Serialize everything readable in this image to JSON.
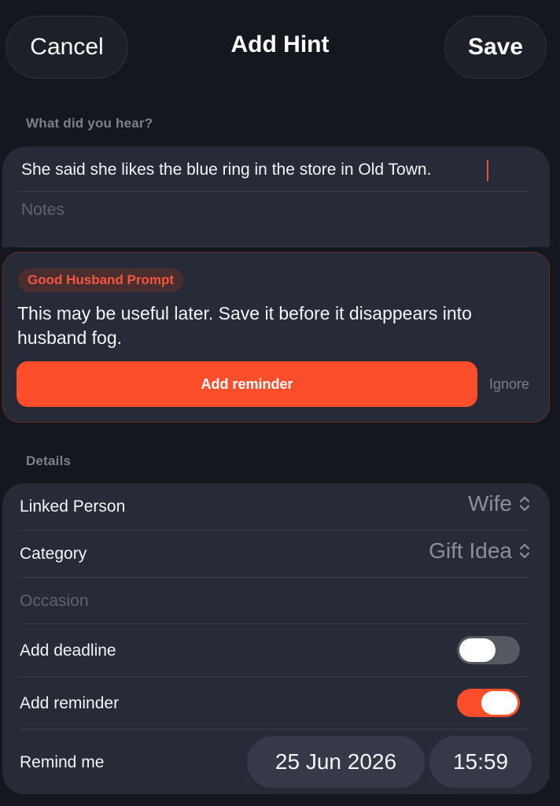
{
  "header": {
    "cancel_label": "Cancel",
    "title": "Add Hint",
    "save_label": "Save"
  },
  "hint_section": {
    "label": "What did you hear?",
    "text": "She said she likes the blue ring in the store in Old Town.",
    "notes_placeholder": "Notes"
  },
  "prompt": {
    "badge": "Good Husband Prompt",
    "message": "This may be useful later. Save it before it disappears into husband fog.",
    "primary_label": "Add reminder",
    "secondary_label": "Ignore"
  },
  "details": {
    "label": "Details",
    "linked_person": {
      "label": "Linked Person",
      "value": "Wife"
    },
    "category": {
      "label": "Category",
      "value": "Gift Idea"
    },
    "occasion_placeholder": "Occasion",
    "add_deadline": {
      "label": "Add deadline",
      "on": false
    },
    "add_reminder": {
      "label": "Add reminder",
      "on": true
    },
    "remind_me": {
      "label": "Remind me",
      "date": "25 Jun 2026",
      "time": "15:59"
    }
  },
  "colors": {
    "background": "#15171e",
    "card": "#272a37",
    "accent": "#fd4e2c",
    "muted_text": "#8b8f9b"
  }
}
